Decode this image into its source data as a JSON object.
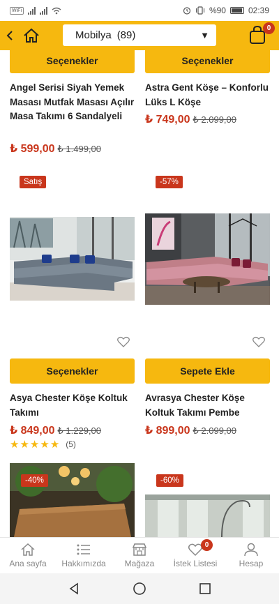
{
  "status_bar": {
    "network_badge": "WiFi",
    "battery_text": "%90",
    "time": "02:39"
  },
  "header": {
    "category": "Mobilya",
    "count": "(89)",
    "cart_count": "0"
  },
  "products": [
    {
      "button": "Seçenekler",
      "title": "Angel Serisi Siyah Yemek Masası Mutfak Masası Açılır Masa Takımı 6 Sandalyeli",
      "price": "₺ 599,00",
      "old_price": "₺ 1.499,00"
    },
    {
      "button": "Seçenekler",
      "title": "Astra Gent Köşe – Konforlu Lüks L Köşe",
      "price": "₺ 749,00",
      "old_price": "₺ 2.099,00"
    },
    {
      "badge": "Satış",
      "button": "Seçenekler",
      "title": "Asya Chester Köşe Koltuk Takımı",
      "price": "₺ 849,00",
      "old_price": "₺ 1.229,00",
      "rating": 5,
      "review_count": "(5)"
    },
    {
      "badge": "-57%",
      "button": "Sepete Ekle",
      "title": "Avrasya Chester Köşe Koltuk Takımı Pembe",
      "price": "₺ 899,00",
      "old_price": "₺ 2.099,00"
    },
    {
      "badge": "-40%"
    },
    {
      "badge": "-60%"
    }
  ],
  "bottom_nav": [
    {
      "label": "Ana sayfa",
      "icon": "home-icon"
    },
    {
      "label": "Hakkımızda",
      "icon": "list-icon"
    },
    {
      "label": "Mağaza",
      "icon": "store-icon"
    },
    {
      "label": "İstek Listesi",
      "icon": "heart-icon",
      "badge": "0"
    },
    {
      "label": "Hesap",
      "icon": "user-icon"
    }
  ],
  "colors": {
    "accent": "#f6b80f",
    "sale": "#c9361c"
  }
}
